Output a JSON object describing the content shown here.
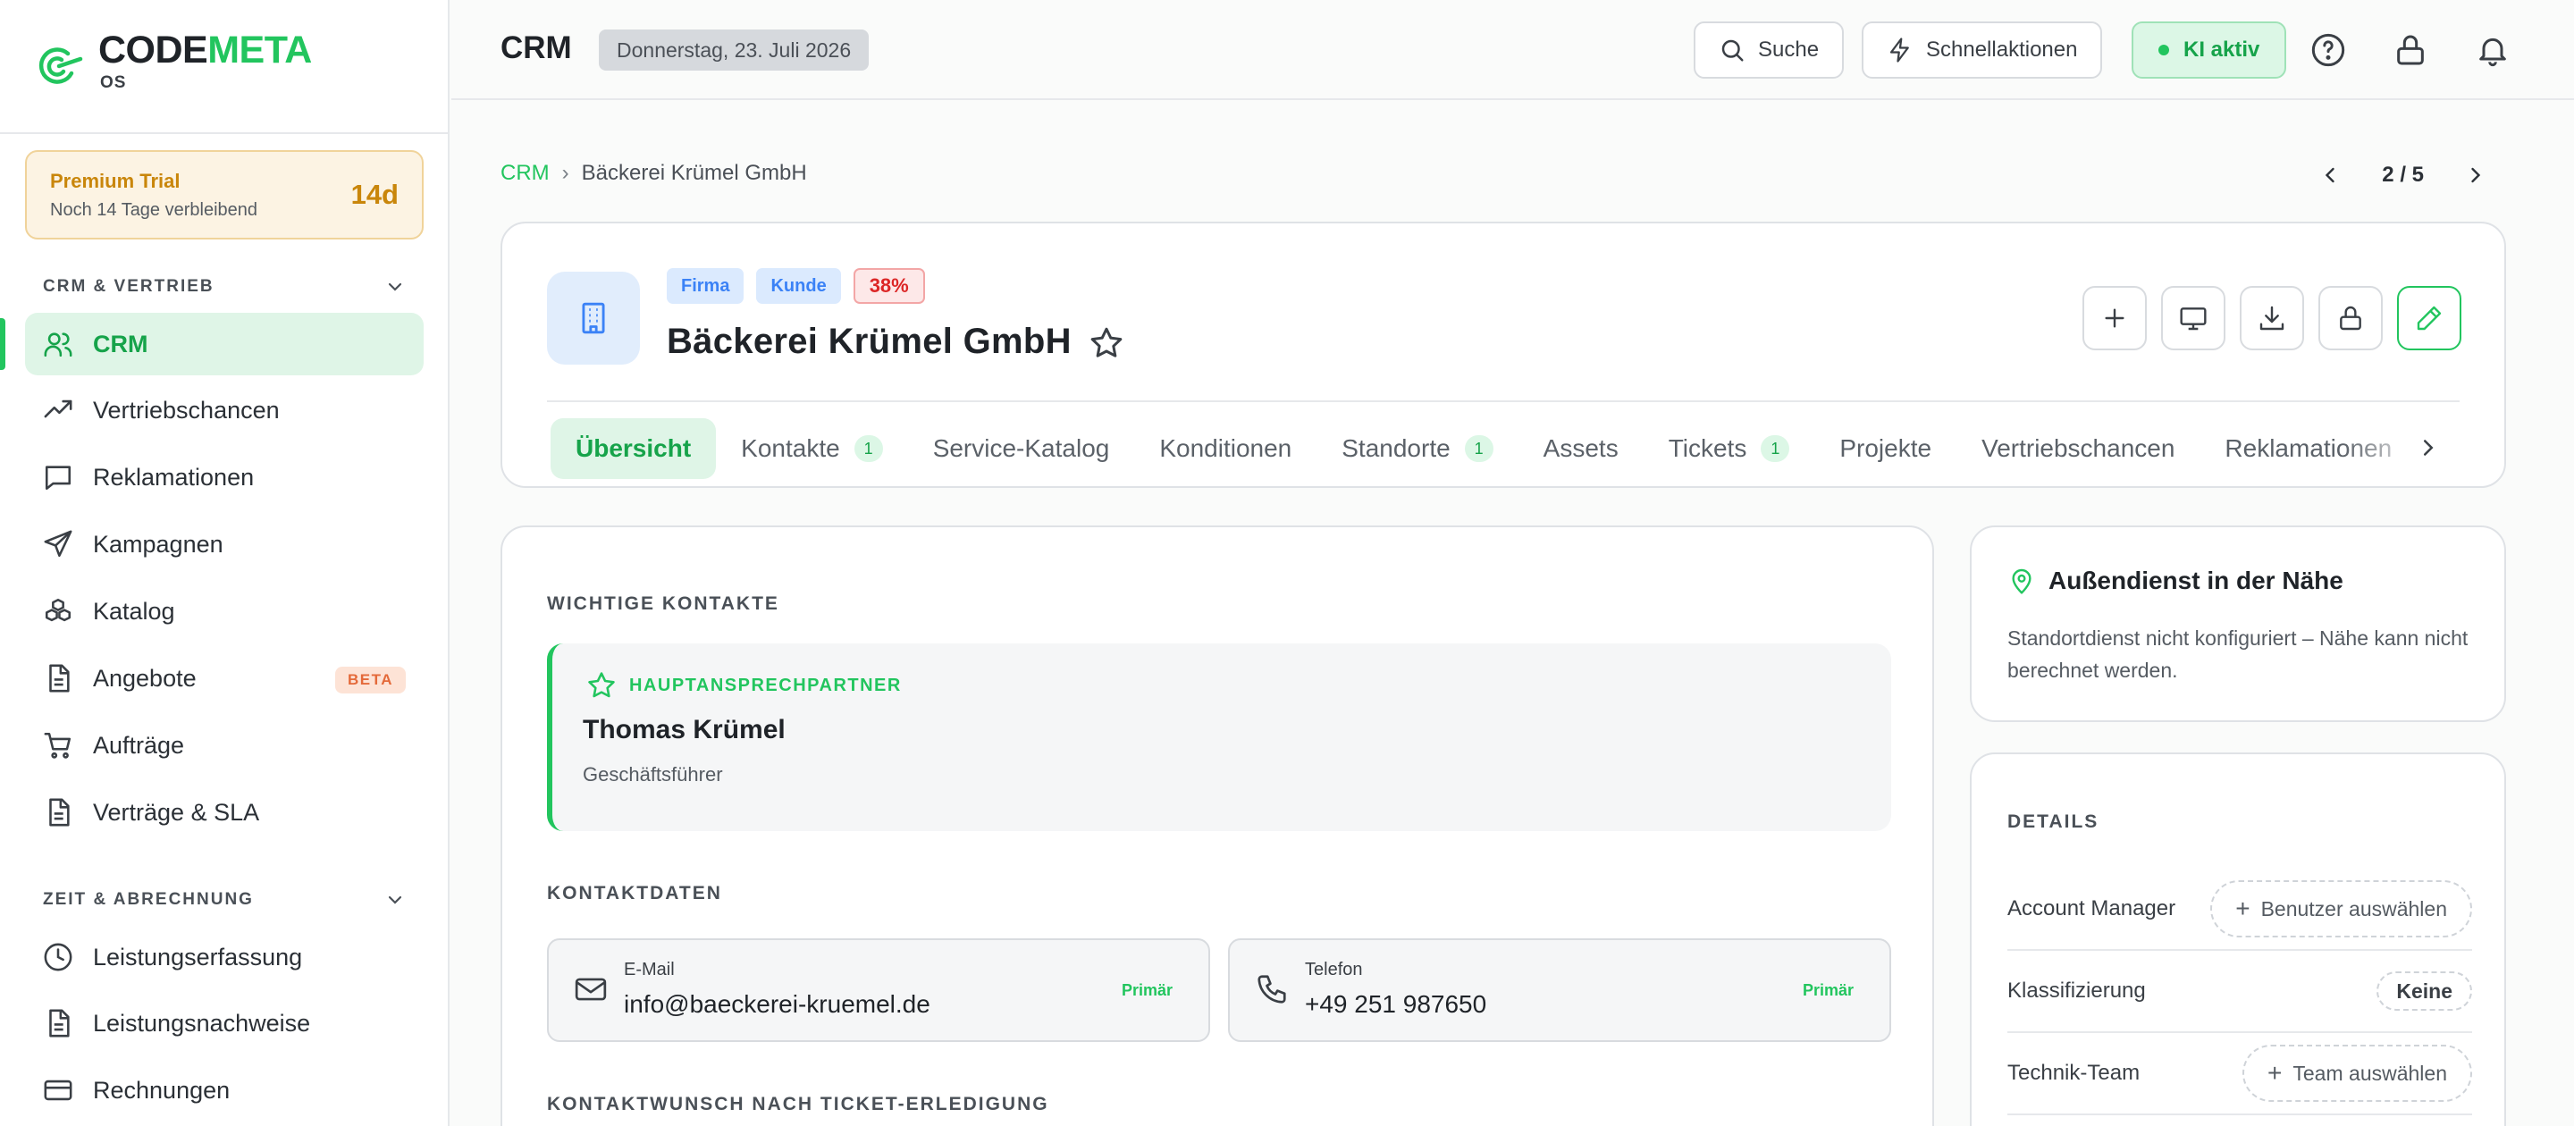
{
  "brand": {
    "name_a": "CODE",
    "name_b": "META",
    "sub": "OS"
  },
  "trial": {
    "title": "Premium Trial",
    "subtitle": "Noch 14 Tage verbleibend",
    "days": "14d"
  },
  "sidebar": {
    "groups": [
      {
        "label": "CRM & VERTRIEB"
      },
      {
        "label": "ZEIT & ABRECHNUNG"
      }
    ],
    "items": [
      {
        "label": "CRM",
        "icon": "users-icon"
      },
      {
        "label": "Vertriebschancen",
        "icon": "trending-up-icon"
      },
      {
        "label": "Reklamationen",
        "icon": "message-square-icon"
      },
      {
        "label": "Kampagnen",
        "icon": "send-icon"
      },
      {
        "label": "Katalog",
        "icon": "boxes-icon"
      },
      {
        "label": "Angebote",
        "icon": "file-text-icon",
        "badge": "BETA"
      },
      {
        "label": "Aufträge",
        "icon": "cart-icon"
      },
      {
        "label": "Verträge & SLA",
        "icon": "file-text-icon"
      },
      {
        "label": "Leistungserfassung",
        "icon": "clock-icon"
      },
      {
        "label": "Leistungsnachweise",
        "icon": "file-text-icon"
      },
      {
        "label": "Rechnungen",
        "icon": "credit-card-icon"
      }
    ]
  },
  "topbar": {
    "title": "CRM",
    "date": "Donnerstag, 23. Juli 2026",
    "search": "Suche",
    "quick": "Schnellaktionen",
    "ai": "KI aktiv"
  },
  "breadcrumb": {
    "root": "CRM",
    "current": "Bäckerei Krümel GmbH"
  },
  "pager": {
    "text": "2 / 5"
  },
  "company": {
    "tags": {
      "type": "Firma",
      "status": "Kunde",
      "score": "38%"
    },
    "name": "Bäckerei Krümel GmbH"
  },
  "tabs": [
    {
      "label": "Übersicht"
    },
    {
      "label": "Kontakte",
      "count": "1"
    },
    {
      "label": "Service-Katalog"
    },
    {
      "label": "Konditionen"
    },
    {
      "label": "Standorte",
      "count": "1"
    },
    {
      "label": "Assets"
    },
    {
      "label": "Tickets",
      "count": "1"
    },
    {
      "label": "Projekte"
    },
    {
      "label": "Vertriebschancen"
    },
    {
      "label": "Reklamationen"
    }
  ],
  "main": {
    "key_contacts_title": "WICHTIGE KONTAKTE",
    "primary": {
      "label": "HAUPTANSPRECHPARTNER",
      "name": "Thomas Krümel",
      "role": "Geschäftsführer"
    },
    "contact_data_title": "KONTAKTDATEN",
    "email": {
      "label": "E-Mail",
      "value": "info@baeckerei-kruemel.de",
      "tag": "Primär"
    },
    "phone": {
      "label": "Telefon",
      "value": "+49 251 987650",
      "tag": "Primär"
    },
    "ticket_title": "KONTAKTWUNSCH NACH TICKET-ERLEDIGUNG"
  },
  "nearby": {
    "title": "Außendienst in der Nähe",
    "text": "Standortdienst nicht konfiguriert – Nähe kann nicht berechnet werden."
  },
  "details": {
    "title": "DETAILS",
    "account_manager": {
      "label": "Account Manager",
      "action": "Benutzer auswählen"
    },
    "classification": {
      "label": "Klassifizierung",
      "value": "Keine"
    },
    "tech_team": {
      "label": "Technik-Team",
      "action": "Team auswählen"
    }
  },
  "colors": {
    "accent": "#22c55e",
    "accent_dark": "#16a34a",
    "trial": "#c9860b",
    "blue": "#3b82f6",
    "red": "#dc2626"
  }
}
